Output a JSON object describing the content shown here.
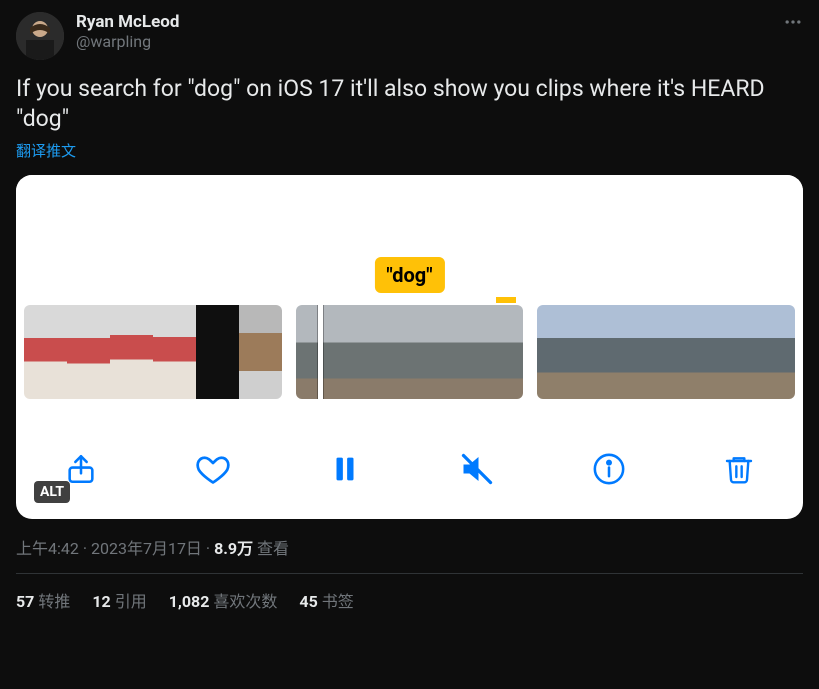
{
  "author": {
    "display_name": "Ryan McLeod",
    "handle": "@warpling"
  },
  "tweet_text": "If you search for \"dog\" on iOS 17 it'll also show you clips where it's HEARD \"dog\"",
  "translate_label": "翻译推文",
  "media": {
    "caption_token": "\"dog\"",
    "alt_badge": "ALT"
  },
  "meta": {
    "time": "上午4:42",
    "date": "2023年7月17日",
    "view_count": "8.9万",
    "view_label": "查看",
    "separator": " · "
  },
  "stats": {
    "retweets": {
      "count": "57",
      "label": "转推"
    },
    "quotes": {
      "count": "12",
      "label": "引用"
    },
    "likes": {
      "count": "1,082",
      "label": "喜欢次数"
    },
    "bookmarks": {
      "count": "45",
      "label": "书签"
    }
  }
}
